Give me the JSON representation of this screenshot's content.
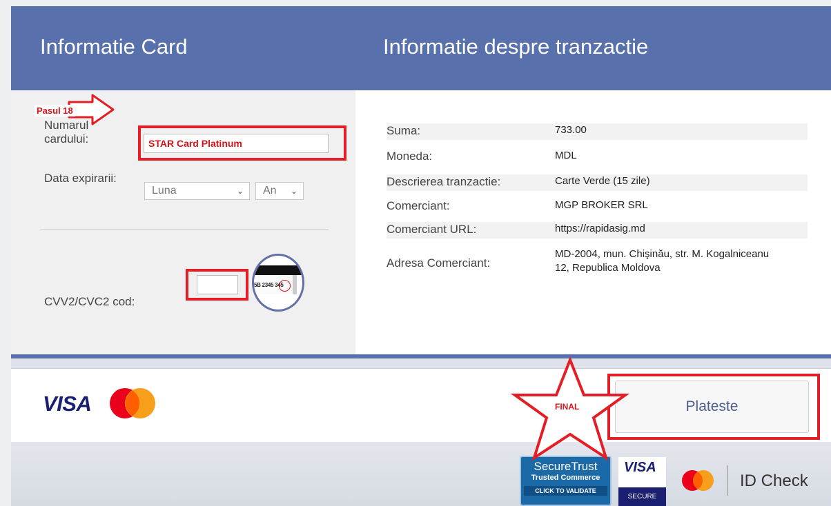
{
  "header": {
    "card_title": "Informatie Card",
    "tranz_title": "Informatie despre tranzactie"
  },
  "card_form": {
    "card_number_label": "Numarul cardului:",
    "card_number_value": "STAR Card Platinum",
    "expiry_label": "Data expirarii:",
    "month_value": "Luna",
    "year_value": "An",
    "cvv_label": "CVV2/CVC2 cod:",
    "cvv_value": "",
    "cvv_hint_text": "5B 2345 345"
  },
  "transaction": {
    "rows": [
      {
        "key": "Suma:",
        "value": "733.00"
      },
      {
        "key": "Moneda:",
        "value": "MDL"
      },
      {
        "key": "Descrierea tranzactie:",
        "value": "Carte Verde (15 zile)"
      },
      {
        "key": "Comerciant:",
        "value": "MGP BROKER SRL"
      },
      {
        "key": "Comerciant URL:",
        "value": "https://rapidasig.md"
      },
      {
        "key": "Adresa Comerciant:",
        "value": "MD-2004, mun. Chişinău, str. M. Kogalniceanu 12, Republica Moldova"
      }
    ]
  },
  "footer": {
    "visa_label": "VISA",
    "pay_button": "Plateste"
  },
  "annotations": {
    "step_label": "Pasul 18",
    "final_label": "FINAL"
  },
  "badges": {
    "securetrust_title": "SecureTrust",
    "securetrust_sub": "Trusted Commerce",
    "securetrust_click": "CLICK TO VALIDATE",
    "visa_secure_visa": "VISA",
    "visa_secure_label": "SECURE",
    "id_check": "ID Check"
  },
  "colors": {
    "header_blue": "#5870ab",
    "annotation_red": "#e41e26",
    "mastercard_red": "#eb001b",
    "mastercard_orange": "#f79e1b",
    "visa_navy": "#1a1f71"
  },
  "icons": [
    "chevron-down-icon",
    "arrow-right-icon",
    "star-icon",
    "mastercard-icon",
    "visa-icon"
  ]
}
